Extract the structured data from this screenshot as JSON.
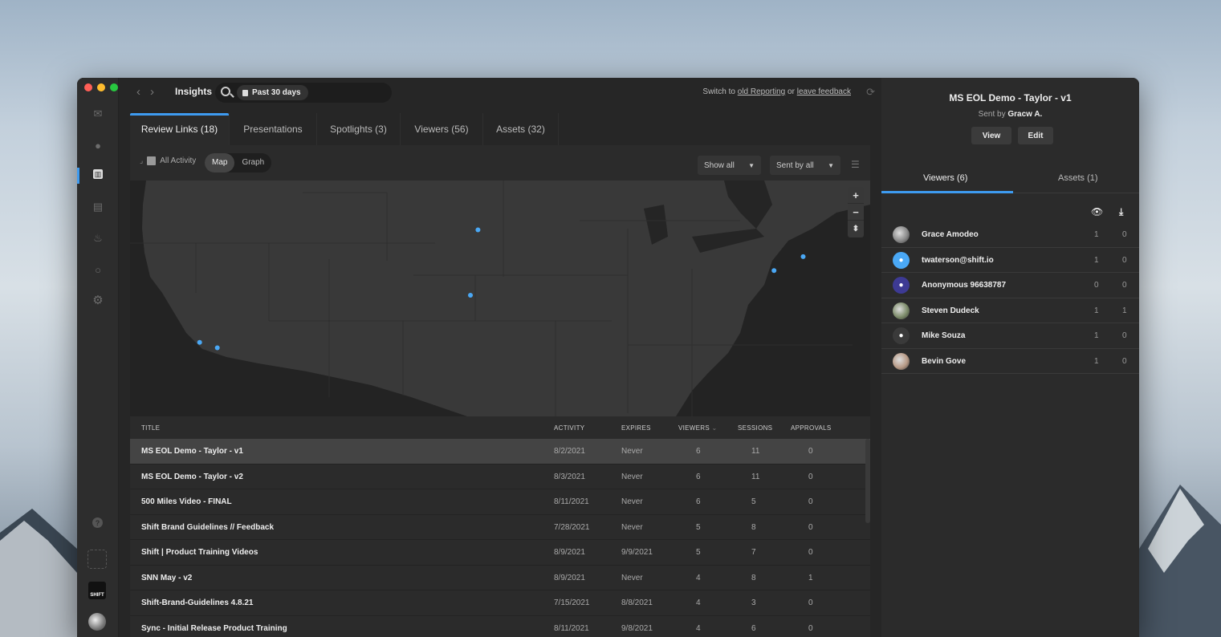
{
  "window": {
    "traffic_lights": [
      "#ff5f57",
      "#febc2e",
      "#28c840"
    ]
  },
  "rail": {
    "icons": [
      {
        "name": "inbox-icon",
        "glyph": "✉"
      },
      {
        "name": "clock-icon",
        "glyph": "●"
      },
      {
        "name": "insights-icon",
        "glyph": "▥",
        "active": true
      },
      {
        "name": "archive-icon",
        "glyph": "▤"
      },
      {
        "name": "flame-icon",
        "glyph": "♨"
      },
      {
        "name": "search-icon",
        "glyph": "○"
      },
      {
        "name": "gear-icon",
        "glyph": "⚙"
      }
    ],
    "help_glyph": "?",
    "workspace_logo_text": "SHIFT",
    "active_color": "#3e9bf0"
  },
  "topbar": {
    "back_glyph": "‹",
    "forward_glyph": "›",
    "title": "Insights",
    "date_filter": "Past 30 days",
    "switch_prefix": "Switch to",
    "old_reporting_link": "old Reporting",
    "or_text": "or",
    "feedback_link": "leave feedback",
    "refresh_glyph": "⟳"
  },
  "tabs": [
    {
      "label": "Review Links (18)",
      "active": true
    },
    {
      "label": "Presentations"
    },
    {
      "label": "Spotlights (3)"
    },
    {
      "label": "Viewers (56)"
    },
    {
      "label": "Assets (32)"
    }
  ],
  "toolbar": {
    "all_activity": "All Activity",
    "view_modes": [
      "Map",
      "Graph"
    ],
    "active_view": "Map",
    "show_filter": "Show all",
    "sender_filter": "Sent by all",
    "dropdown_glyph": "▼",
    "filter_glyph": "☰"
  },
  "map": {
    "zoom_in": "+",
    "zoom_out": "−",
    "reset_glyph": "⬍",
    "marker_color": "#4aa8f5",
    "markers": [
      {
        "label": "Minnesota",
        "lat": 44.9,
        "lon": -97.0
      },
      {
        "label": "Kansas",
        "lat": 38.8,
        "lon": -97.6
      },
      {
        "label": "Los Angeles",
        "lat": 34.4,
        "lon": -119.0
      },
      {
        "label": "San Diego area",
        "lat": 33.9,
        "lon": -117.6
      },
      {
        "label": "New York",
        "lat": 41.1,
        "lon": -73.6
      },
      {
        "label": "Boston",
        "lat": 42.4,
        "lon": -71.3
      }
    ]
  },
  "table": {
    "headers": [
      "TITLE",
      "ACTIVITY",
      "EXPIRES",
      "VIEWERS",
      "SESSIONS",
      "APPROVALS"
    ],
    "sort_glyph": "⌄",
    "rows": [
      {
        "title": "MS EOL Demo - Taylor - v1",
        "activity": "8/2/2021",
        "expires": "Never",
        "viewers": "6",
        "sessions": "11",
        "approvals": "0",
        "selected": true
      },
      {
        "title": "MS EOL Demo - Taylor - v2",
        "activity": "8/3/2021",
        "expires": "Never",
        "viewers": "6",
        "sessions": "11",
        "approvals": "0"
      },
      {
        "title": "500 Miles Video - FINAL",
        "activity": "8/11/2021",
        "expires": "Never",
        "viewers": "6",
        "sessions": "5",
        "approvals": "0"
      },
      {
        "title": "Shift Brand Guidelines // Feedback",
        "activity": "7/28/2021",
        "expires": "Never",
        "viewers": "5",
        "sessions": "8",
        "approvals": "0"
      },
      {
        "title": "Shift | Product Training Videos",
        "activity": "8/9/2021",
        "expires": "9/9/2021",
        "viewers": "5",
        "sessions": "7",
        "approvals": "0"
      },
      {
        "title": "SNN May - v2",
        "activity": "8/9/2021",
        "expires": "Never",
        "viewers": "4",
        "sessions": "8",
        "approvals": "1"
      },
      {
        "title": "Shift-Brand-Guidelines 4.8.21",
        "activity": "7/15/2021",
        "expires": "8/8/2021",
        "viewers": "4",
        "sessions": "3",
        "approvals": "0"
      },
      {
        "title": "Sync - Initial Release Product Training",
        "activity": "8/11/2021",
        "expires": "9/8/2021",
        "viewers": "4",
        "sessions": "6",
        "approvals": "0"
      }
    ]
  },
  "side": {
    "title": "MS EOL Demo - Taylor - v1",
    "sent_by_prefix": "Sent by",
    "sent_by_name": "Gracw A.",
    "view_button": "View",
    "edit_button": "Edit",
    "tabs": [
      {
        "label": "Viewers (6)",
        "active": true
      },
      {
        "label": "Assets (1)"
      }
    ],
    "views_glyph": "👁",
    "downloads_glyph": "⤓",
    "viewers": [
      {
        "name": "Grace Amodeo",
        "views": "1",
        "downloads": "0",
        "avatar": "photo",
        "color": "#8a8a8a"
      },
      {
        "name": "twaterson@shift.io",
        "views": "1",
        "downloads": "0",
        "avatar": "person",
        "color": "#4aa8f5"
      },
      {
        "name": "Anonymous 96638787",
        "views": "0",
        "downloads": "0",
        "avatar": "person",
        "color": "#3d3a94"
      },
      {
        "name": "Steven Dudeck",
        "views": "1",
        "downloads": "1",
        "avatar": "photo",
        "color": "#7d8c6a"
      },
      {
        "name": "Mike Souza",
        "views": "1",
        "downloads": "0",
        "avatar": "person",
        "color": "#3a3a3a"
      },
      {
        "name": "Bevin Gove",
        "views": "1",
        "downloads": "0",
        "avatar": "photo",
        "color": "#b79a86"
      }
    ]
  }
}
